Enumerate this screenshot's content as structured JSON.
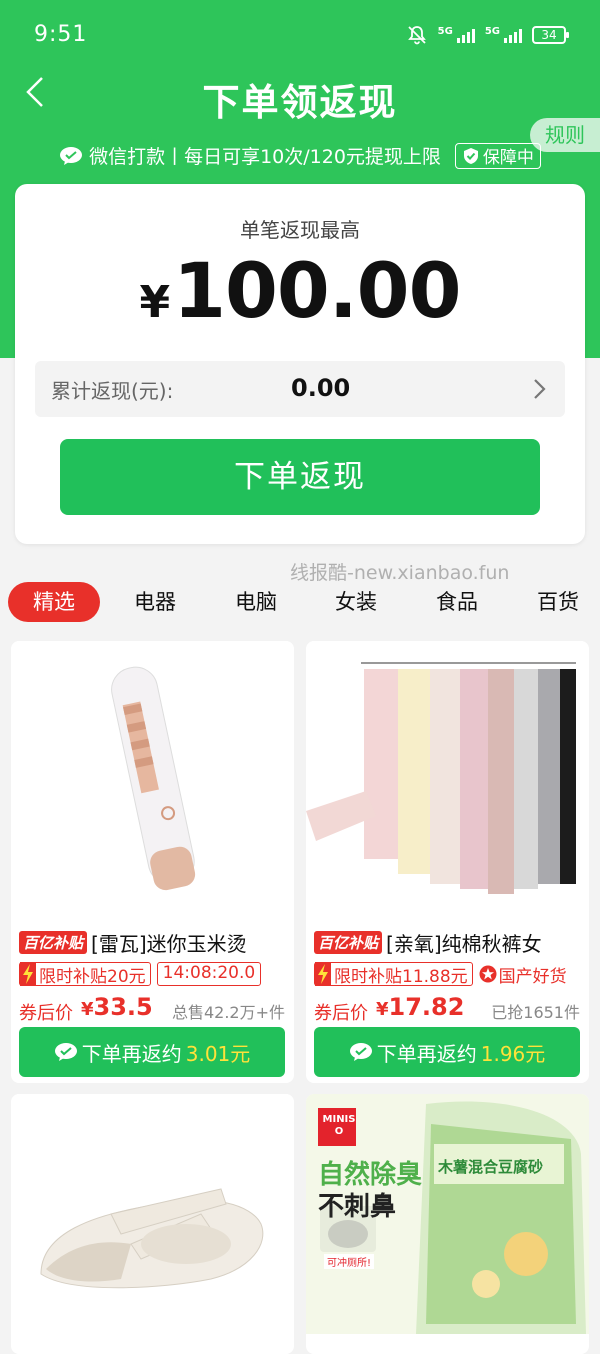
{
  "status": {
    "time": "9:51",
    "battery": "34",
    "net1": "5G",
    "net2": "5G"
  },
  "header": {
    "title": "下单领返现",
    "rules": "规则"
  },
  "subline": {
    "text": "微信打款丨每日可享10次/120元提现上限",
    "guarantee": "保障中"
  },
  "card": {
    "label": "单笔返现最高",
    "currency": "¥",
    "amount": "100.00",
    "cumulative_label": "累计返现(元):",
    "cumulative_value": "0.00",
    "button": "下单返现"
  },
  "watermark": "线报酷-new.xianbao.fun",
  "tabs": [
    "精选",
    "电器",
    "电脑",
    "女装",
    "食品",
    "百货"
  ],
  "products": [
    {
      "badge": "百亿补贴",
      "title": "[雷瓦]迷你玉米烫",
      "subsidy": "限时补贴20元",
      "timer": "14:08:20.0",
      "price_label": "券后价",
      "currency": "¥",
      "price": "33.5",
      "sold": "总售42.2万+件",
      "rebate_label": "下单再返约",
      "rebate_amount": "3.01元"
    },
    {
      "badge": "百亿补贴",
      "title": "[亲氧]纯棉秋裤女",
      "subsidy": "限时补贴11.88元",
      "tag": "国产好货",
      "price_label": "券后价",
      "currency": "¥",
      "price": "17.82",
      "sold": "已抢1651件",
      "rebate_label": "下单再返约",
      "rebate_amount": "1.96元"
    },
    {},
    {
      "brand": "MINISO",
      "ad_line1": "自然除臭",
      "ad_line2": "不刺鼻",
      "pack_text": "木薯混合豆腐砂",
      "note": "可冲厕所!"
    }
  ],
  "colors": {
    "brand_green": "#2ec55a",
    "button_green": "#21c05a",
    "accent_red": "#e8302a",
    "rebate_yellow": "#ffe23a"
  }
}
